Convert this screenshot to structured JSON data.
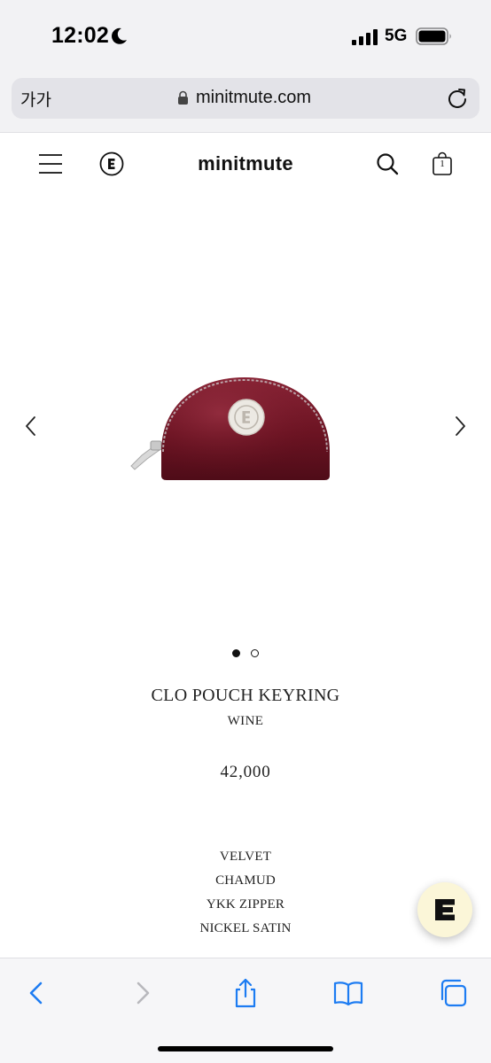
{
  "status_bar": {
    "time": "12:02",
    "network": "5G",
    "icons": [
      "moon-icon",
      "signal-icon",
      "battery-icon"
    ]
  },
  "browser": {
    "reader_label": "가가",
    "url": "minitmute.com",
    "icons": [
      "lock-icon",
      "reload-icon"
    ]
  },
  "site_header": {
    "brand": "minitmute",
    "cart_count": "1",
    "icons": [
      "menu-icon",
      "brand-badge-icon",
      "search-icon",
      "cart-icon"
    ]
  },
  "gallery": {
    "slide_count": 2,
    "active_slide": 1,
    "icons": [
      "chevron-left-icon",
      "chevron-right-icon"
    ],
    "colors": {
      "pouch": "#6b1322",
      "pouch_highlight": "#8a2436",
      "badge": "#ece9e3"
    }
  },
  "product": {
    "name": "CLO POUCH KEYRING",
    "color_name": "WINE",
    "price": "42,000",
    "materials": [
      "VELVET",
      "CHAMUD",
      "YKK ZIPPER",
      "NICKEL SATIN"
    ]
  },
  "chat": {
    "icon": "chat-logo-icon",
    "background": "#fbf6d8"
  },
  "toolbar": {
    "icons": [
      "back-icon",
      "forward-icon",
      "share-icon",
      "bookmarks-icon",
      "tabs-icon"
    ],
    "accent": "#1d7cf2",
    "disabled": "#b8b8bd"
  }
}
